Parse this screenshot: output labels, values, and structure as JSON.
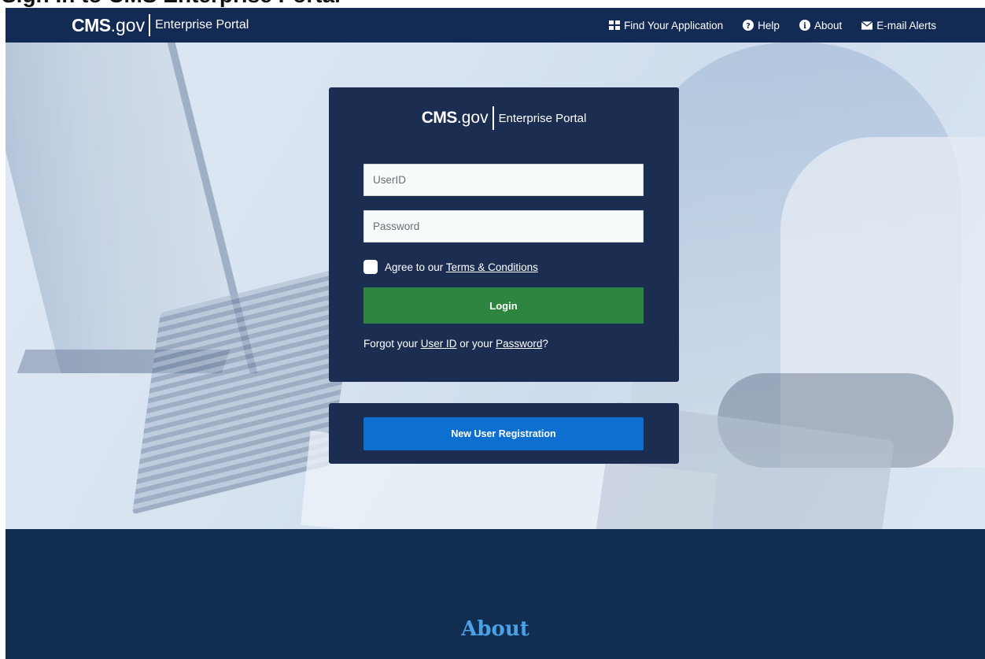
{
  "page_heading": "Sign In to CMS Enterprise Portal",
  "header": {
    "brand": {
      "cms": "CMS",
      "gov": ".gov",
      "portal": "Enterprise Portal"
    },
    "nav": [
      {
        "label": "Find Your Application",
        "icon": "grid-icon"
      },
      {
        "label": "Help",
        "icon": "question-circle-icon"
      },
      {
        "label": "About",
        "icon": "info-circle-icon"
      },
      {
        "label": "E-mail Alerts",
        "icon": "envelope-icon"
      }
    ]
  },
  "login": {
    "brand": {
      "cms": "CMS",
      "gov": ".gov",
      "portal": "Enterprise Portal"
    },
    "userid_placeholder": "UserID",
    "password_placeholder": "Password",
    "agree_prefix": "Agree to our ",
    "terms_link": "Terms & Conditions",
    "login_button": "Login",
    "forgot_prefix": "Forgot your ",
    "forgot_userid": "User ID",
    "forgot_middle": " or your ",
    "forgot_password": "Password",
    "forgot_suffix": "?"
  },
  "register": {
    "button": "New User Registration"
  },
  "footer": {
    "title": "About"
  },
  "colors": {
    "header_bg": "#132a55",
    "card_bg": "#1c2d52",
    "login_button": "#2e8540",
    "register_button": "#0d70d1",
    "footer_bg": "#112e51",
    "footer_title": "#4aa1e6"
  }
}
